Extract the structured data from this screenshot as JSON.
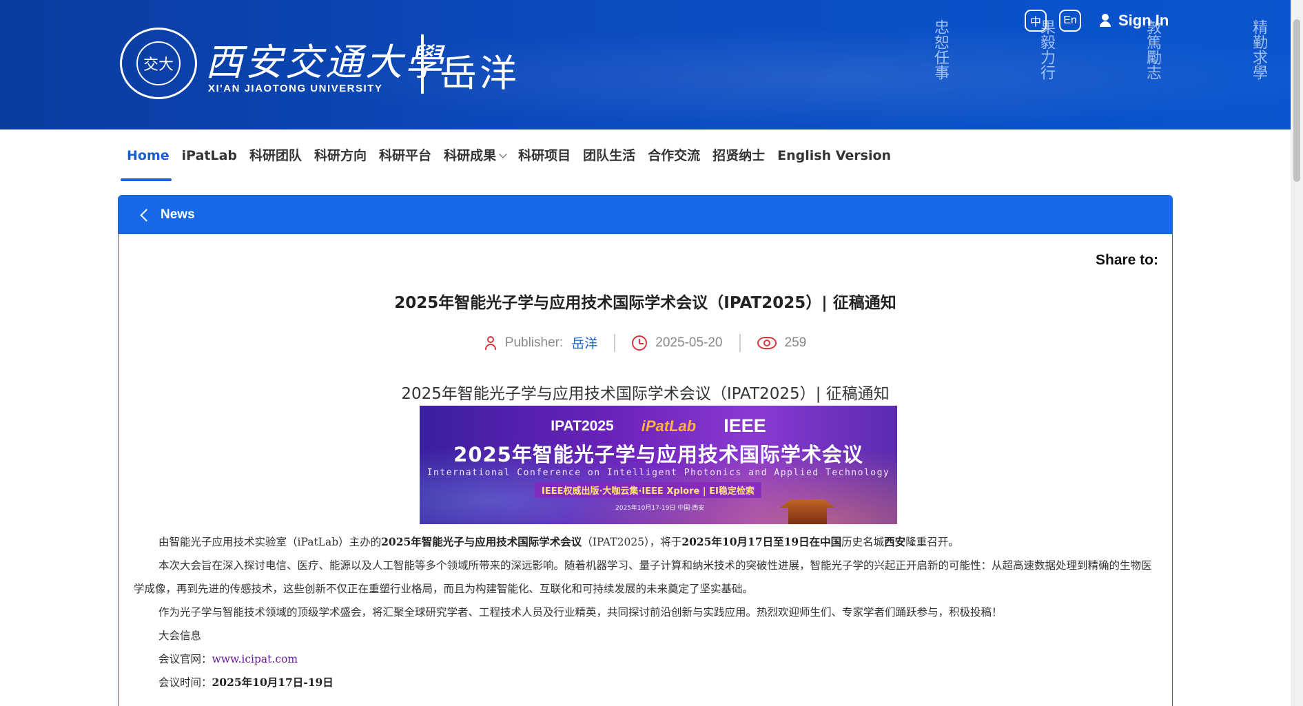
{
  "header": {
    "seal_text": "交大",
    "university_cn": "西安交通大學",
    "university_en": "XI'AN JIAOTONG UNIVERSITY",
    "site_name": "岳洋",
    "motto_columns": [
      "忠恕任事",
      "果毅力行",
      "敦篤勵志",
      "精勤求學"
    ],
    "lang_cn": "中",
    "lang_en": "En",
    "signin_label": "Sign In"
  },
  "nav": {
    "items": [
      {
        "label": "Home",
        "active": true
      },
      {
        "label": "iPatLab"
      },
      {
        "label": "科研团队"
      },
      {
        "label": "科研方向"
      },
      {
        "label": "科研平台"
      },
      {
        "label": "科研成果",
        "dropdown": true
      },
      {
        "label": "科研项目"
      },
      {
        "label": "团队生活"
      },
      {
        "label": "合作交流"
      },
      {
        "label": "招贤纳士"
      },
      {
        "label": "English Version"
      }
    ]
  },
  "panel": {
    "back_label": "News",
    "share_label": "Share to:"
  },
  "article": {
    "title": "2025年智能光子学与应用技术国际学术会议（IPAT2025）| 征稿通知",
    "publisher_label": "Publisher:",
    "publisher_name": "岳洋",
    "date": "2025-05-20",
    "views": "259",
    "subtitle": "2025年智能光子学与应用技术国际学术会议（IPAT2025）| 征稿通知"
  },
  "banner": {
    "logo_ipat": "IPAT2025",
    "logo_ipatlab": "iPatLab",
    "logo_ieee": "IEEE",
    "title_cn": "2025年智能光子学与应用技术国际学术会议",
    "title_en": "International Conference on Intelligent Photonics and Applied Technology",
    "pub_line": "IEEE权威出版·大咖云集·IEEE Xplore | EI稳定检索",
    "date_line": "2025年10月17-19日  中国·西安"
  },
  "body": {
    "p1_a": "由智能光子应用技术实验室（iPatLab）主办的",
    "p1_b": "2025年智能光子与应用技术国际学术会议",
    "p1_c": "（IPAT2025），将于",
    "p1_d": "2025年10月17日至19日在中国",
    "p1_e": "历史名城",
    "p1_f": "西安",
    "p1_g": "隆重召开。",
    "p2": "本次大会旨在深入探讨电信、医疗、能源以及人工智能等多个领域所带来的深远影响。随着机器学习、量子计算和纳米技术的突破性进展，智能光子学的兴起正开启新的可能性：从超高速数据处理到精确的生物医学成像，再到先进的传感技术，这些创新不仅正在重塑行业格局，而且为构建智能化、互联化和可持续发展的未来奠定了坚实基础。",
    "p3": "作为光子学与智能技术领域的顶级学术盛会，将汇聚全球研究学者、工程技术人员及行业精英，共同探讨前沿创新与实践应用。热烈欢迎师生们、专家学者们踊跃参与，积极投稿！",
    "p4": "大会信息",
    "p5_label": "会议官网：",
    "p5_url": "www.icipat.com",
    "p6_label": "会议时间：",
    "p6_value": "2025年10月17日-19日"
  }
}
